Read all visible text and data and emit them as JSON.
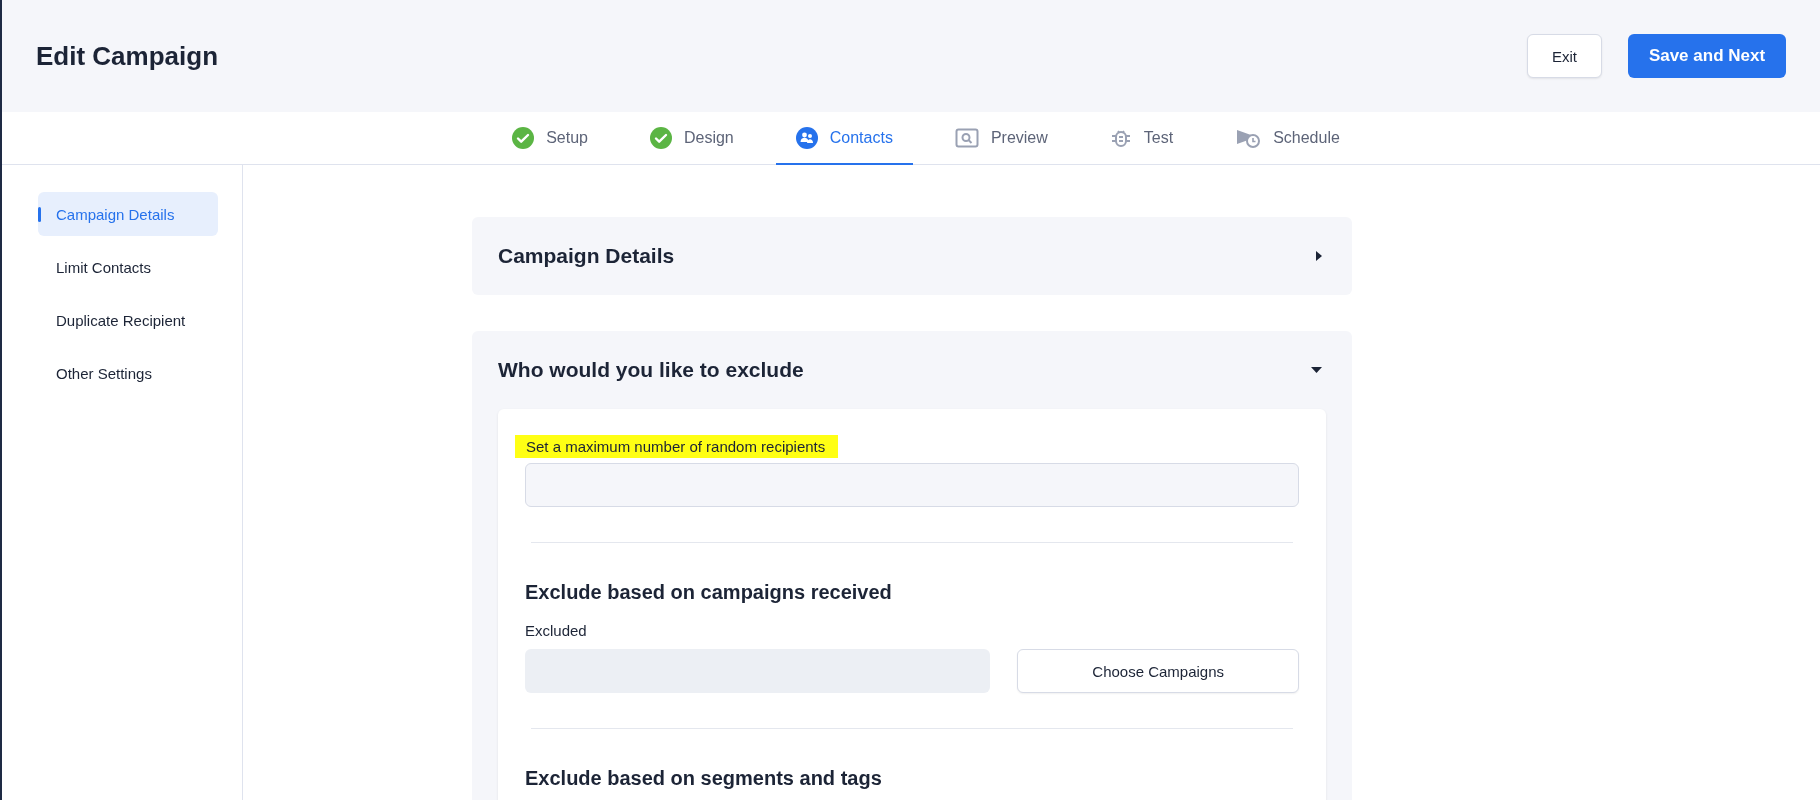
{
  "header": {
    "title": "Edit Campaign",
    "buttons": [
      {
        "label": "Exit",
        "kind": "secondary"
      },
      {
        "label": "Save and Next",
        "kind": "primary"
      }
    ]
  },
  "steps": [
    {
      "label": "Setup",
      "done": true,
      "selected": false
    },
    {
      "label": "Design",
      "done": true,
      "selected": false
    },
    {
      "label": "Contacts",
      "done": false,
      "selected": true
    },
    {
      "label": "Preview",
      "done": false,
      "selected": false
    },
    {
      "label": "Test",
      "done": false,
      "selected": false
    },
    {
      "label": "Schedule",
      "done": false,
      "selected": false
    }
  ],
  "sidebar": {
    "items": [
      {
        "label": "Campaign Details",
        "selected": true
      },
      {
        "label": "Limit Contacts",
        "selected": false
      },
      {
        "label": "Duplicate Recipient",
        "selected": false
      },
      {
        "label": "Other Settings",
        "selected": false
      }
    ]
  },
  "sections": [
    {
      "title": "Campaign Details",
      "expanded": false
    },
    {
      "title": "Who would you like to exclude",
      "expanded": true,
      "max_recipients": {
        "label": "Set a maximum number of random recipients",
        "highlighted": true
      },
      "campaigns_exclusion": {
        "heading": "Exclude based on campaigns received",
        "label": "Excluded",
        "button": "Choose Campaigns"
      },
      "segments_exclusion": {
        "heading": "Exclude based on segments and tags"
      }
    }
  ]
}
